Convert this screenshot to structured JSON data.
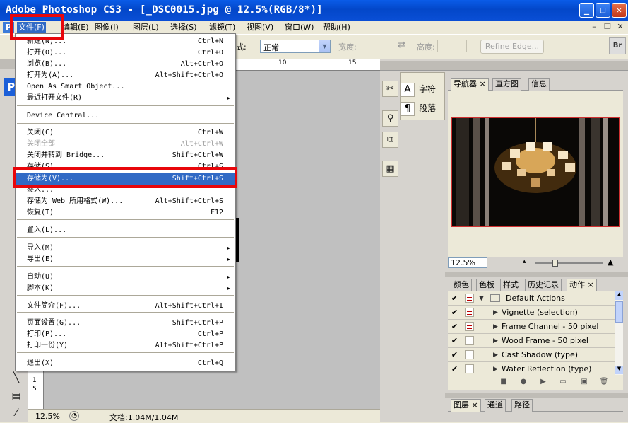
{
  "window": {
    "title": "Photoshop CS3 - [_DSC0015.jpg @ 12.5%(RGB/8*)]",
    "app_prefix": "Adobe ",
    "min": "_",
    "max": "□",
    "close": "✕"
  },
  "menubar": {
    "items": [
      "文件(F)",
      "编辑(E)",
      "图像(I)",
      "图层(L)",
      "选择(S)",
      "滤镜(T)",
      "视图(V)",
      "窗口(W)",
      "帮助(H)"
    ]
  },
  "options": {
    "style_label": "式:",
    "style_value": "正常",
    "width_label": "宽度:",
    "height_label": "高度:",
    "refine_edge": "Refine Edge...",
    "bridge": "Br"
  },
  "file_menu": {
    "items": [
      {
        "label": "新建(N)...",
        "shortcut": "Ctrl+N"
      },
      {
        "label": "打开(O)...",
        "shortcut": "Ctrl+O"
      },
      {
        "label": "浏览(B)...",
        "shortcut": "Alt+Ctrl+O"
      },
      {
        "label": "打开为(A)...",
        "shortcut": "Alt+Shift+Ctrl+O"
      },
      {
        "label": "Open As Smart Object...",
        "shortcut": ""
      },
      {
        "label": "最近打开文件(R)",
        "shortcut": "",
        "submenu": true
      },
      {
        "label": "Device Central...",
        "shortcut": ""
      },
      {
        "label": "关闭(C)",
        "shortcut": "Ctrl+W"
      },
      {
        "label": "关闭全部",
        "shortcut": "Alt+Ctrl+W",
        "disabled": true
      },
      {
        "label": "关闭并转到 Bridge...",
        "shortcut": "Shift+Ctrl+W"
      },
      {
        "label": "存储(S)",
        "shortcut": "Ctrl+S"
      },
      {
        "label": "存储为(V)...",
        "shortcut": "Shift+Ctrl+S",
        "highlighted": true
      },
      {
        "label": "签入...",
        "shortcut": ""
      },
      {
        "label": "存储为 Web 所用格式(W)...",
        "shortcut": "Alt+Shift+Ctrl+S"
      },
      {
        "label": "恢复(T)",
        "shortcut": "F12"
      },
      {
        "label": "置入(L)...",
        "shortcut": ""
      },
      {
        "label": "导入(M)",
        "shortcut": "",
        "submenu": true
      },
      {
        "label": "导出(E)",
        "shortcut": "",
        "submenu": true
      },
      {
        "label": "自动(U)",
        "shortcut": "",
        "submenu": true
      },
      {
        "label": "脚本(K)",
        "shortcut": "",
        "submenu": true
      },
      {
        "label": "文件简介(F)...",
        "shortcut": "Alt+Shift+Ctrl+I"
      },
      {
        "label": "页面设置(G)...",
        "shortcut": "Shift+Ctrl+P"
      },
      {
        "label": "打印(P)...",
        "shortcut": "Ctrl+P"
      },
      {
        "label": "打印一份(Y)",
        "shortcut": "Alt+Shift+Ctrl+P"
      },
      {
        "label": "退出(X)",
        "shortcut": "Ctrl+Q"
      }
    ]
  },
  "ruler": {
    "top_marks": [
      "10",
      "15"
    ],
    "left_marks": [
      "1",
      "5"
    ]
  },
  "status": {
    "zoom": "12.5%",
    "doc": "文档:1.04M/1.04M"
  },
  "char_panels": {
    "char": "字符",
    "para": "段落",
    "char_icon": "A",
    "para_icon": "¶"
  },
  "navigator": {
    "tabs": [
      "导航器",
      "直方图",
      "信息"
    ],
    "zoom": "12.5%"
  },
  "actions_panel": {
    "tabs": [
      "颜色",
      "色板",
      "样式",
      "历史记录",
      "动作"
    ],
    "rows": [
      {
        "name": "Default Actions",
        "folder": true,
        "dialog": true
      },
      {
        "name": "Vignette (selection)",
        "dialog": true
      },
      {
        "name": "Frame Channel - 50 pixel",
        "dialog": true
      },
      {
        "name": "Wood Frame - 50 pixel",
        "dialog": false
      },
      {
        "name": "Cast Shadow (type)",
        "dialog": false
      },
      {
        "name": "Water Reflection (type)",
        "dialog": false
      }
    ]
  },
  "layers_panel": {
    "tabs": [
      "图层",
      "通道",
      "路径"
    ]
  },
  "colors": {
    "highlight": "#316ac5",
    "annotation": "#e8060b"
  }
}
